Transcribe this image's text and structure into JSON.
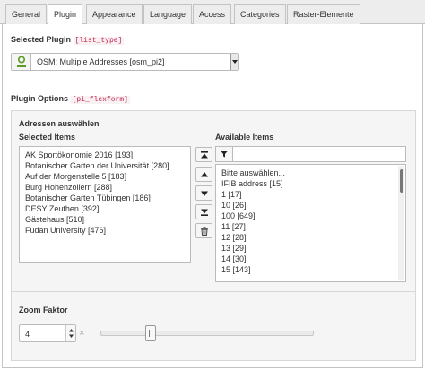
{
  "tabs": [
    {
      "label": "General",
      "active": false
    },
    {
      "label": "Plugin",
      "active": true
    },
    {
      "label": "Appearance",
      "active": false
    },
    {
      "label": "Language",
      "active": false
    },
    {
      "label": "Access",
      "active": false
    },
    {
      "label": "Categories",
      "active": false
    },
    {
      "label": "Raster-Elemente",
      "active": false
    }
  ],
  "selected_plugin": {
    "label": "Selected Plugin",
    "code": "[list_type]",
    "value": "OSM: Multiple Addresses [osm_pi2]",
    "icon": "map-marker-icon"
  },
  "plugin_options": {
    "label": "Plugin Options",
    "code": "[pi_flexform]"
  },
  "addresses": {
    "section_title": "Adressen auswählen",
    "selected_label": "Selected Items",
    "available_label": "Available Items",
    "selected_items": [
      "AK Sportökonomie 2016 [193]",
      "Botanischer Garten der Universität [280]",
      "Auf der Morgenstelle 5 [183]",
      "Burg Hohenzollern [288]",
      "Botanischer Garten Tübingen [186]",
      "DESY Zeuthen [392]",
      "Gästehaus [510]",
      "Fudan University [476]"
    ],
    "available_items": [
      "Bitte auswählen...",
      "IFIB address [15]",
      "1 [17]",
      "10 [26]",
      "100 [649]",
      "11 [27]",
      "12 [28]",
      "13 [29]",
      "14 [30]",
      "15 [143]"
    ],
    "filter_value": "",
    "buttons": [
      "move-to-top-icon",
      "move-up-icon",
      "move-down-icon",
      "move-to-bottom-icon",
      "trash-icon"
    ]
  },
  "zoom": {
    "label": "Zoom Faktor",
    "value": "4",
    "clear_symbol": "×",
    "slider_level": 0.22
  },
  "colors": {
    "code_text": "#c7254e",
    "marker": "#5c9a22"
  }
}
